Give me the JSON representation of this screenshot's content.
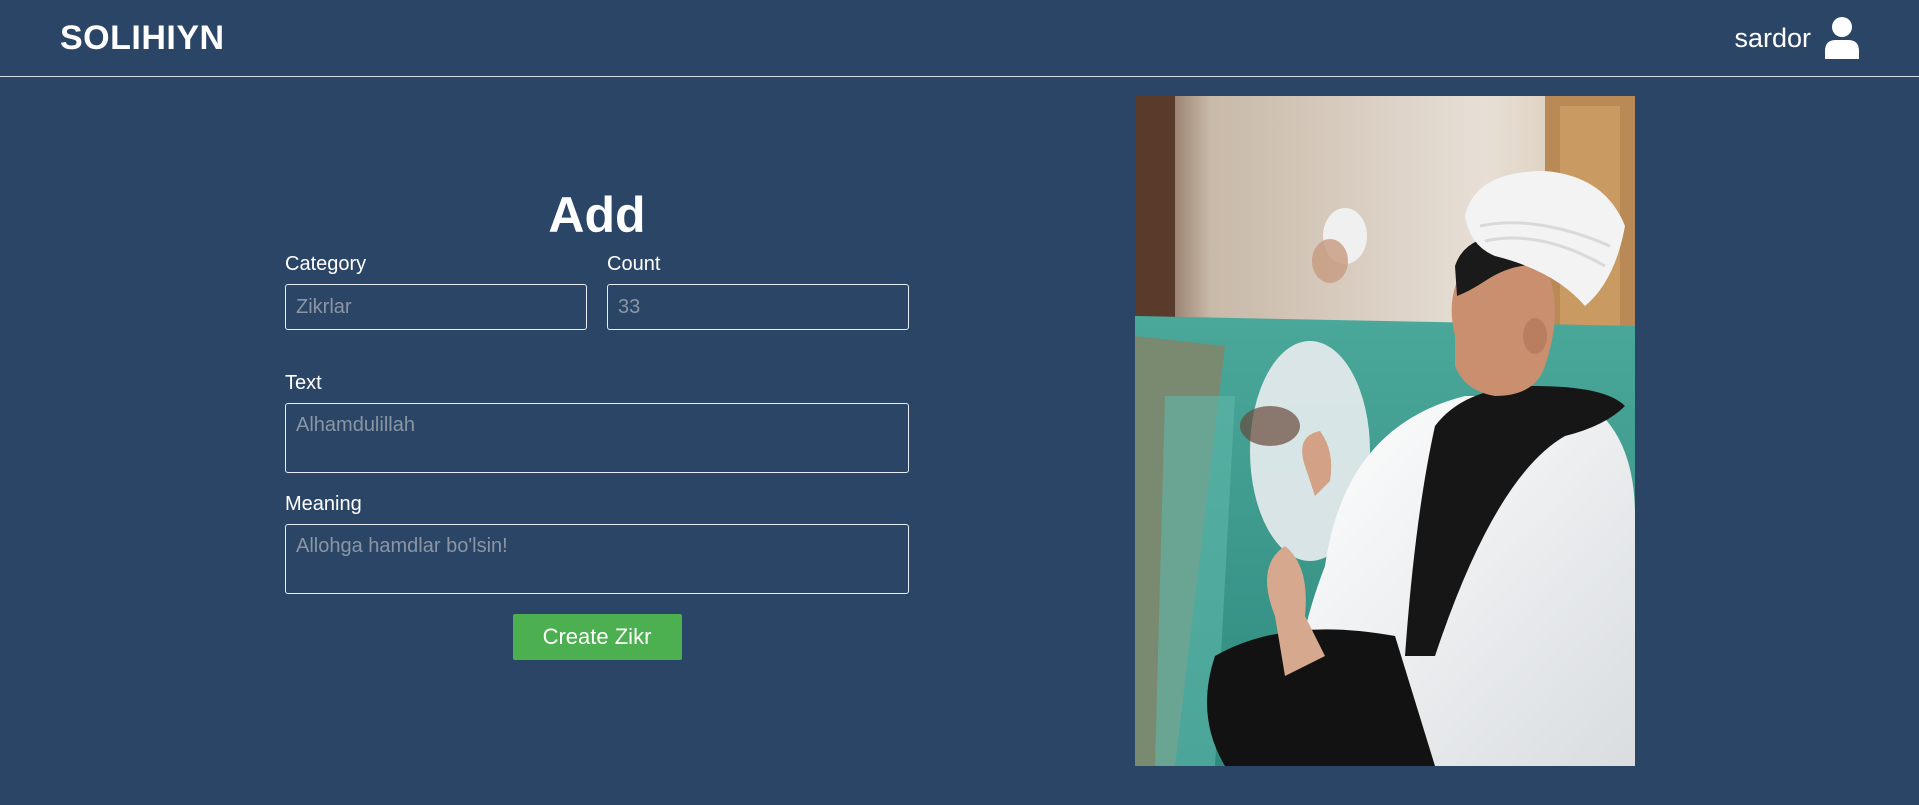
{
  "header": {
    "logo": "SOLIHIYN",
    "username": "sardor",
    "user_icon": "user-icon"
  },
  "form": {
    "title": "Add",
    "category": {
      "label": "Category",
      "placeholder": "Zikrlar",
      "value": ""
    },
    "count": {
      "label": "Count",
      "placeholder": "33",
      "value": ""
    },
    "text": {
      "label": "Text",
      "placeholder": "Alhamdulillah",
      "value": ""
    },
    "meaning": {
      "label": "Meaning",
      "placeholder": "Allohga hamdlar bo'lsin!",
      "value": ""
    },
    "submit_label": "Create Zikr"
  },
  "colors": {
    "background": "#2a4565",
    "button": "#4caf50",
    "text": "#ffffff"
  }
}
